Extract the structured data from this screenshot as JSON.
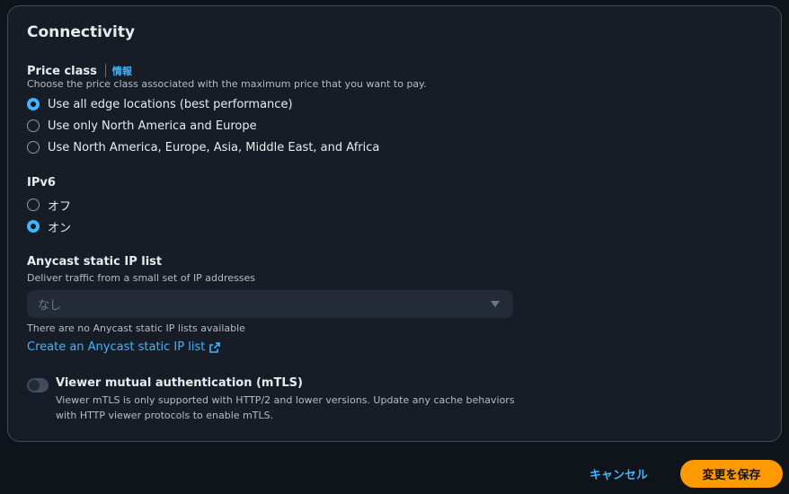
{
  "section": {
    "title": "Connectivity"
  },
  "price_class": {
    "label": "Price class",
    "info_link": "情報",
    "description": "Choose the price class associated with the maximum price that you want to pay.",
    "options": [
      {
        "label": "Use all edge locations (best performance)",
        "selected": true
      },
      {
        "label": "Use only North America and Europe",
        "selected": false
      },
      {
        "label": "Use North America, Europe, Asia, Middle East, and Africa",
        "selected": false
      }
    ]
  },
  "ipv6": {
    "label": "IPv6",
    "options": [
      {
        "label": "オフ",
        "selected": false
      },
      {
        "label": "オン",
        "selected": true
      }
    ]
  },
  "anycast": {
    "label": "Anycast static IP list",
    "description": "Deliver traffic from a small set of IP addresses",
    "select_value": "なし",
    "hint": "There are no Anycast static IP lists available",
    "create_link": "Create an Anycast static IP list"
  },
  "mtls": {
    "label": "Viewer mutual authentication (mTLS)",
    "description_line1": "Viewer mTLS is only supported with HTTP/2 and lower versions. Update any cache behaviors",
    "description_line2": "with HTTP viewer protocols to enable mTLS.",
    "enabled": false
  },
  "footer": {
    "cancel_label": "キャンセル",
    "save_label": "変更を保存"
  },
  "colors": {
    "accent": "#42b4ff",
    "primary_button": "#ff9900",
    "background": "#0f141b",
    "panel": "#161d26"
  }
}
